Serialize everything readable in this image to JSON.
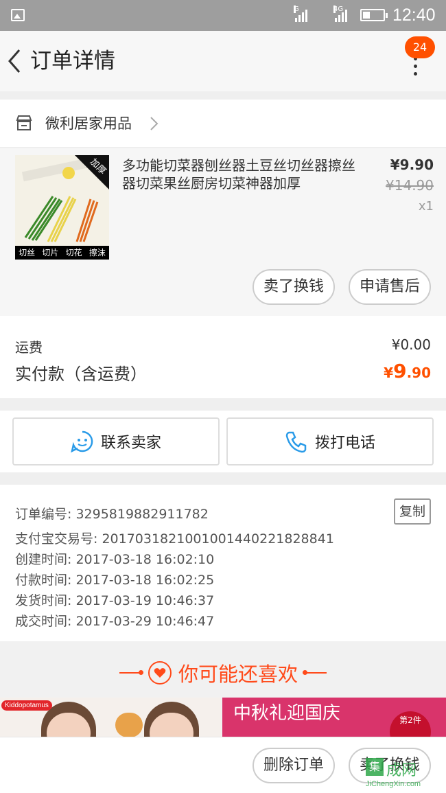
{
  "status_bar": {
    "sim1_label": "G",
    "sim2_label": "4G",
    "time": "12:40"
  },
  "header": {
    "title": "订单详情",
    "badge_count": "24"
  },
  "store": {
    "name": "微利居家用品"
  },
  "product": {
    "title": "多功能切菜器刨丝器土豆丝切丝器擦丝器切菜果丝厨房切菜神器加厚",
    "price": "¥9.90",
    "original_price": "¥14.90",
    "quantity": "x1",
    "thumb_corner": "加厚",
    "thumb_tags": [
      "切丝",
      "切片",
      "切花",
      "擦沫"
    ],
    "sell_button": "卖了换钱",
    "aftersale_button": "申请售后"
  },
  "costs": {
    "shipping_label": "运费",
    "shipping_value": "¥0.00",
    "total_label": "实付款（含运费）",
    "total_yen": "¥",
    "total_int": "9",
    "total_dec": ".90"
  },
  "contact": {
    "seller_label": "联系卖家",
    "phone_label": "拨打电话"
  },
  "order_info": {
    "copy_label": "复制",
    "rows": [
      "订单编号: 3295819882911782",
      "支付宝交易号: 2017031821001001440221828841",
      "创建时间: 2017-03-18 16:02:10",
      "付款时间: 2017-03-18 16:02:25",
      "发货时间: 2017-03-19 10:46:37",
      "成交时间: 2017-03-29 10:46:47"
    ]
  },
  "recommend": {
    "title": "你可能还喜欢",
    "brand": "Kiddopotamus",
    "promo_text": "中秋礼迎国庆",
    "promo_badge": "第2件"
  },
  "bottom_bar": {
    "delete_label": "删除订单",
    "sell_label": "卖了换钱"
  },
  "watermark": {
    "box": "集",
    "text": "成网",
    "url": "JiChengXin.com"
  },
  "colors": {
    "accent": "#ff5000",
    "status_bar": "#9e9e9e",
    "contact_icon": "#2a9be8"
  }
}
